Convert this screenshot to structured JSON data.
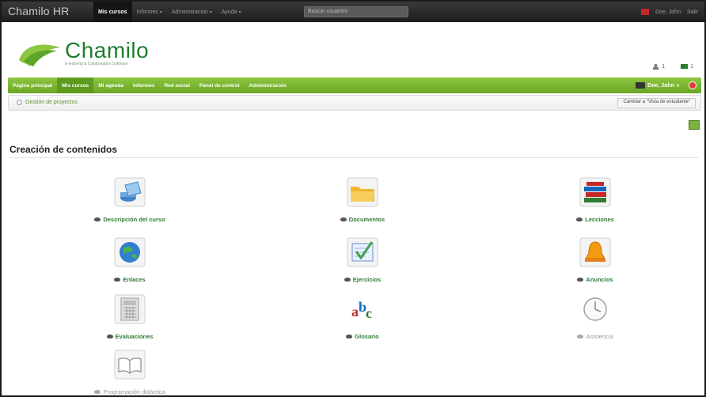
{
  "topbar": {
    "brand": "Chamilo HR",
    "nav": [
      {
        "label": "Mis cursos",
        "active": true,
        "caret": false
      },
      {
        "label": "Informes",
        "active": false,
        "caret": true
      },
      {
        "label": "Administración",
        "active": false,
        "caret": true
      },
      {
        "label": "Ayuda",
        "active": false,
        "caret": true
      }
    ],
    "search_placeholder": "Buscar usuarios",
    "user": "Doe, John",
    "logout": "Salir"
  },
  "header": {
    "logo_text": "Chamilo",
    "logo_sub": "E-learning & Collaboration Software",
    "icon_counts": [
      "1",
      "1"
    ]
  },
  "greennav": {
    "items": [
      {
        "label": "Página principal",
        "active": false
      },
      {
        "label": "Mis cursos",
        "active": true
      },
      {
        "label": "Mi agenda",
        "active": false
      },
      {
        "label": "Informes",
        "active": false
      },
      {
        "label": "Red social",
        "active": false
      },
      {
        "label": "Panel de control",
        "active": false
      },
      {
        "label": "Administración",
        "active": false
      }
    ],
    "user": "Doe, John"
  },
  "breadcrumb": {
    "course": "Gestión de proyectos",
    "student_view": "Cambiar a \"Vista de estudiante\""
  },
  "section": {
    "title": "Creación de contenidos"
  },
  "tools": [
    {
      "label": "Descripción del curso",
      "icon": "course-description-icon",
      "visible": true
    },
    {
      "label": "Documentos",
      "icon": "folder-icon",
      "visible": true
    },
    {
      "label": "Lecciones",
      "icon": "books-icon",
      "visible": true
    },
    {
      "label": "Enlaces",
      "icon": "globe-icon",
      "visible": true
    },
    {
      "label": "Ejercicios",
      "icon": "exercise-icon",
      "visible": true
    },
    {
      "label": "Anuncios",
      "icon": "bell-icon",
      "visible": true
    },
    {
      "label": "Evaluaciones",
      "icon": "calculator-icon",
      "visible": true
    },
    {
      "label": "Glosario",
      "icon": "glossary-abc-icon",
      "visible": true
    },
    {
      "label": "Asistencia",
      "icon": "clock-icon",
      "visible": false
    },
    {
      "label": "Programación didáctica",
      "icon": "open-book-icon",
      "visible": false
    }
  ],
  "colors": {
    "brand_green": "#8dc63f",
    "link_green": "#2e7d32",
    "topbar": "#2a2a2a"
  }
}
